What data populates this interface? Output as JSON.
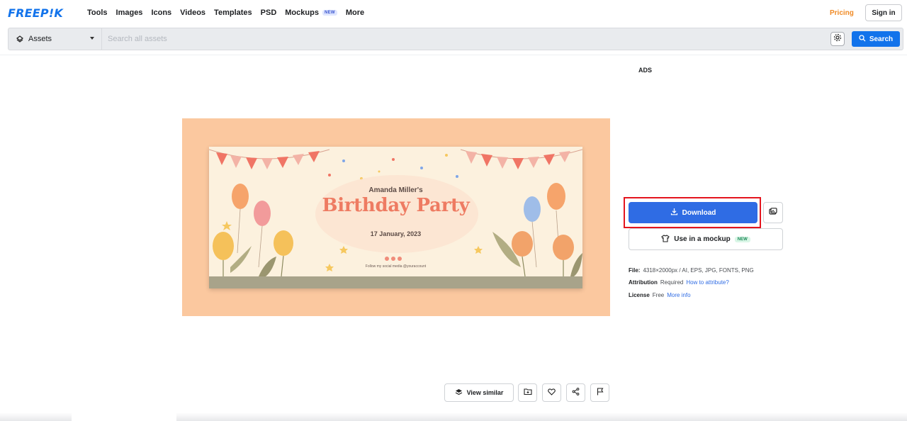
{
  "brand": {
    "logo": "FREEP!K",
    "accent": "#1273eb"
  },
  "nav": {
    "items": [
      {
        "label": "Tools"
      },
      {
        "label": "Images"
      },
      {
        "label": "Icons"
      },
      {
        "label": "Videos"
      },
      {
        "label": "Templates"
      },
      {
        "label": "PSD"
      },
      {
        "label": "Mockups",
        "badge": "NEW"
      },
      {
        "label": "More"
      }
    ],
    "pricing": "Pricing",
    "signin": "Sign in"
  },
  "search": {
    "category": "Assets",
    "placeholder": "Search all assets",
    "button": "Search"
  },
  "ads_label": "ADS",
  "preview": {
    "name": "Amanda Miller's",
    "title": "Birthday Party",
    "date": "17 January, 2023",
    "social": "Follow my social media @youraccount"
  },
  "actions": {
    "download": "Download",
    "mockup": "Use in a mockup",
    "mockup_badge": "NEW",
    "highlight_color": "#e4151e"
  },
  "meta": {
    "file_label": "File:",
    "file_value": "4318×2000px / AI, EPS, JPG, FONTS, PNG",
    "attribution_label": "Attribution",
    "attribution_value": "Required",
    "attribution_link": "How to attribute?",
    "license_label": "License",
    "license_value": "Free",
    "license_link": "More info"
  },
  "bottom": {
    "view_similar": "View similar"
  }
}
